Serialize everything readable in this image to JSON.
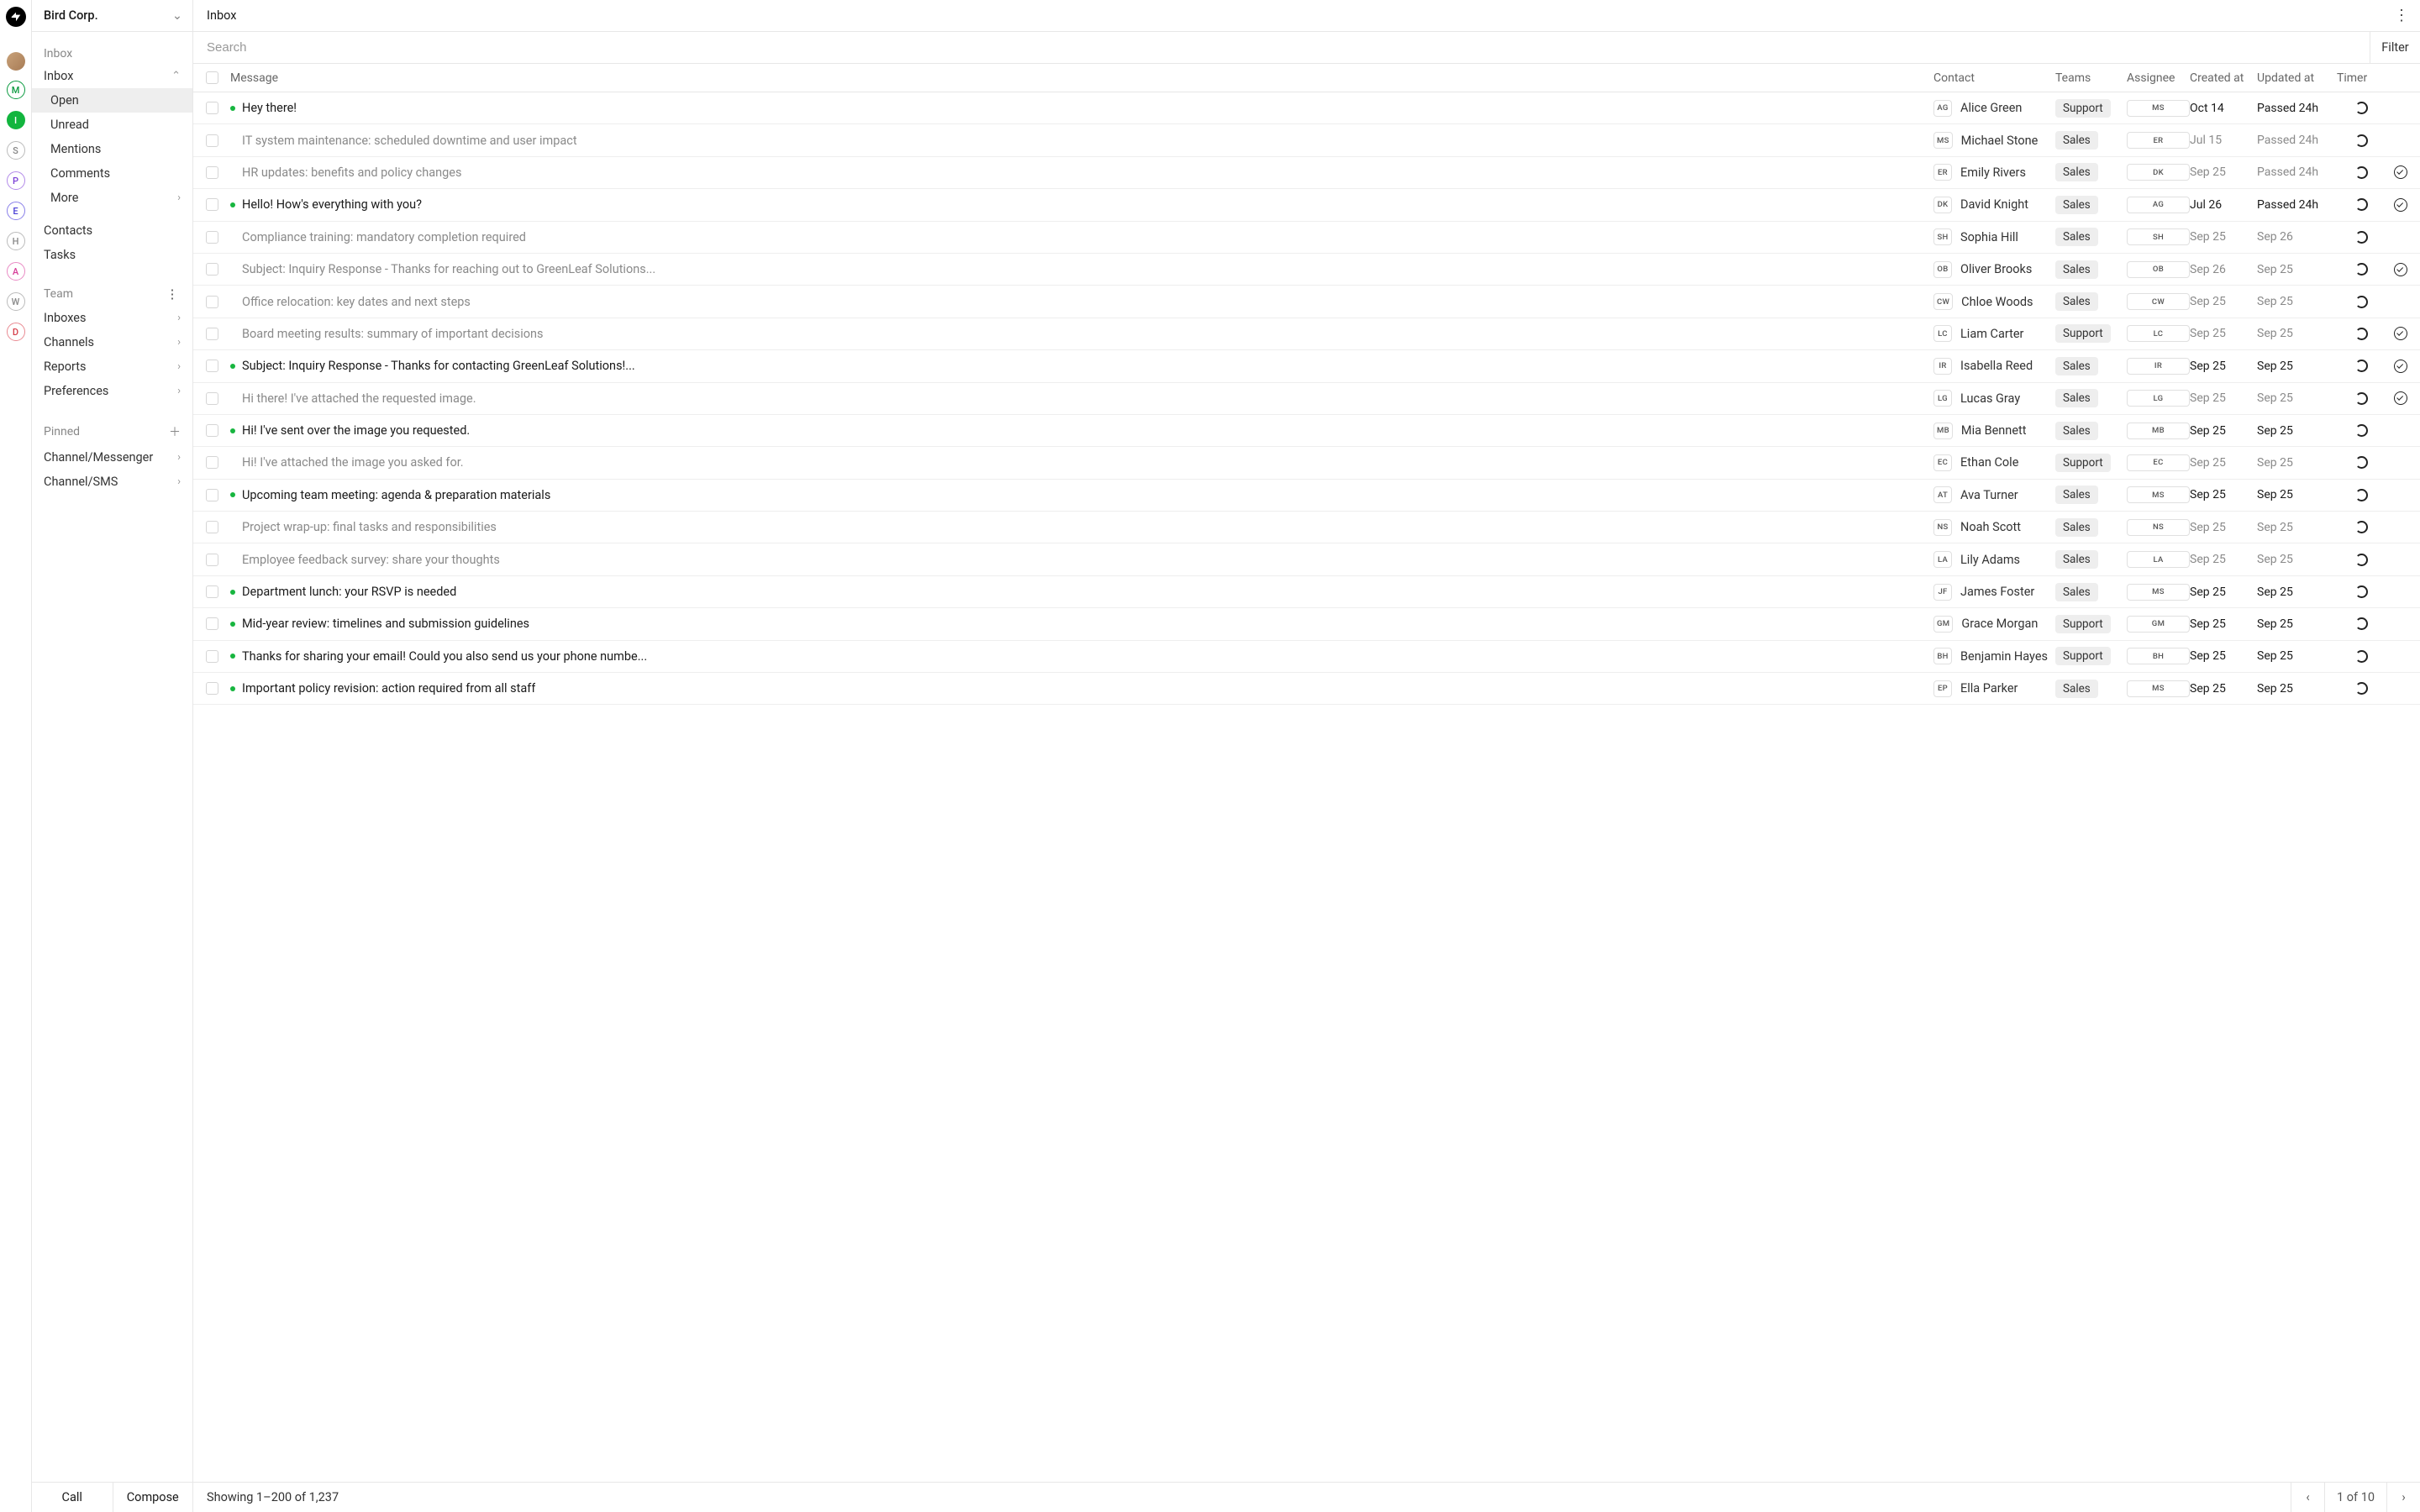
{
  "org": {
    "name": "Bird Corp."
  },
  "view": {
    "title": "Inbox"
  },
  "sidebar": {
    "inbox_label": "Inbox",
    "sections": {
      "inbox": "Inbox",
      "open": "Open",
      "unread": "Unread",
      "mentions": "Mentions",
      "comments": "Comments",
      "more": "More",
      "contacts": "Contacts",
      "tasks": "Tasks"
    },
    "team_heading": "Team",
    "team": {
      "inboxes": "Inboxes",
      "channels": "Channels",
      "reports": "Reports",
      "preferences": "Preferences"
    },
    "pinned_heading": "Pinned",
    "pinned": {
      "messenger": "Channel/Messenger",
      "sms": "Channel/SMS"
    }
  },
  "footer": {
    "call": "Call",
    "compose": "Compose",
    "showing": "Showing 1–200 of 1,237",
    "page": "1 of 10"
  },
  "search": {
    "placeholder": "Search"
  },
  "filter_label": "Filter",
  "columns": {
    "message": "Message",
    "contact": "Contact",
    "teams": "Teams",
    "assignee": "Assignee",
    "created": "Created at",
    "updated": "Updated at",
    "timer": "Timer"
  },
  "rail": [
    "M",
    "I",
    "S",
    "P",
    "E",
    "H",
    "A",
    "W",
    "D"
  ],
  "rows": [
    {
      "unread": true,
      "msg": "Hey there!",
      "ci": "AG",
      "contact": "Alice Green",
      "team": "Support",
      "assignee": "MS",
      "created": "Oct 14",
      "updated": "Passed 24h",
      "check": false
    },
    {
      "unread": false,
      "msg": "IT system maintenance: scheduled downtime and user impact",
      "ci": "MS",
      "contact": "Michael Stone",
      "team": "Sales",
      "assignee": "ER",
      "created": "Jul 15",
      "updated": "Passed 24h",
      "check": false
    },
    {
      "unread": false,
      "msg": "HR updates: benefits and policy changes",
      "ci": "ER",
      "contact": "Emily Rivers",
      "team": "Sales",
      "assignee": "DK",
      "created": "Sep 25",
      "updated": "Passed 24h",
      "check": true
    },
    {
      "unread": true,
      "msg": "Hello! How's everything with you?",
      "ci": "DK",
      "contact": "David Knight",
      "team": "Sales",
      "assignee": "AG",
      "created": "Jul 26",
      "updated": "Passed 24h",
      "check": true
    },
    {
      "unread": false,
      "msg": "Compliance training: mandatory completion required",
      "ci": "SH",
      "contact": "Sophia Hill",
      "team": "Sales",
      "assignee": "SH",
      "created": "Sep 25",
      "updated": "Sep 26",
      "check": false
    },
    {
      "unread": false,
      "msg": "Subject: Inquiry Response - Thanks for reaching out to GreenLeaf Solutions...",
      "ci": "OB",
      "contact": "Oliver Brooks",
      "team": "Sales",
      "assignee": "OB",
      "created": "Sep 26",
      "updated": "Sep 25",
      "check": true
    },
    {
      "unread": false,
      "msg": "Office relocation: key dates and next steps",
      "ci": "CW",
      "contact": "Chloe Woods",
      "team": "Sales",
      "assignee": "CW",
      "created": "Sep 25",
      "updated": "Sep 25",
      "check": false
    },
    {
      "unread": false,
      "msg": "Board meeting results: summary of important decisions",
      "ci": "LC",
      "contact": "Liam Carter",
      "team": "Support",
      "assignee": "LC",
      "created": "Sep 25",
      "updated": "Sep 25",
      "check": true
    },
    {
      "unread": true,
      "msg": "Subject: Inquiry Response - Thanks for contacting GreenLeaf Solutions!...",
      "ci": "IR",
      "contact": "Isabella Reed",
      "team": "Sales",
      "assignee": "IR",
      "created": "Sep 25",
      "updated": "Sep 25",
      "check": true
    },
    {
      "unread": false,
      "msg": "Hi there! I've attached the requested image.",
      "ci": "LG",
      "contact": "Lucas Gray",
      "team": "Sales",
      "assignee": "LG",
      "created": "Sep 25",
      "updated": "Sep 25",
      "check": true
    },
    {
      "unread": true,
      "msg": "Hi! I've sent over the image you requested.",
      "ci": "MB",
      "contact": "Mia Bennett",
      "team": "Sales",
      "assignee": "MB",
      "created": "Sep 25",
      "updated": "Sep 25",
      "check": false
    },
    {
      "unread": false,
      "msg": "Hi! I've attached the image you asked for.",
      "ci": "EC",
      "contact": "Ethan Cole",
      "team": "Support",
      "assignee": "EC",
      "created": "Sep 25",
      "updated": "Sep 25",
      "check": false
    },
    {
      "unread": true,
      "msg": "Upcoming team meeting: agenda & preparation materials",
      "ci": "AT",
      "contact": "Ava Turner",
      "team": "Sales",
      "assignee": "MS",
      "created": "Sep 25",
      "updated": "Sep 25",
      "check": false
    },
    {
      "unread": false,
      "msg": "Project wrap-up: final tasks and responsibilities",
      "ci": "NS",
      "contact": "Noah Scott",
      "team": "Sales",
      "assignee": "NS",
      "created": "Sep 25",
      "updated": "Sep 25",
      "check": false
    },
    {
      "unread": false,
      "msg": "Employee feedback survey: share your thoughts",
      "ci": "LA",
      "contact": "Lily Adams",
      "team": "Sales",
      "assignee": "LA",
      "created": "Sep 25",
      "updated": "Sep 25",
      "check": false
    },
    {
      "unread": true,
      "msg": "Department lunch: your RSVP is needed",
      "ci": "JF",
      "contact": "James Foster",
      "team": "Sales",
      "assignee": "MS",
      "created": "Sep 25",
      "updated": "Sep 25",
      "check": false
    },
    {
      "unread": true,
      "msg": "Mid-year review: timelines and submission guidelines",
      "ci": "GM",
      "contact": "Grace Morgan",
      "team": "Support",
      "assignee": "GM",
      "created": "Sep 25",
      "updated": "Sep 25",
      "check": false
    },
    {
      "unread": true,
      "msg": "Thanks for sharing your email! Could you also send us your phone numbe...",
      "ci": "BH",
      "contact": "Benjamin Hayes",
      "team": "Support",
      "assignee": "BH",
      "created": "Sep 25",
      "updated": "Sep 25",
      "check": false
    },
    {
      "unread": true,
      "msg": "Important policy revision: action required from all staff",
      "ci": "EP",
      "contact": "Ella Parker",
      "team": "Sales",
      "assignee": "MS",
      "created": "Sep 25",
      "updated": "Sep 25",
      "check": false
    }
  ]
}
